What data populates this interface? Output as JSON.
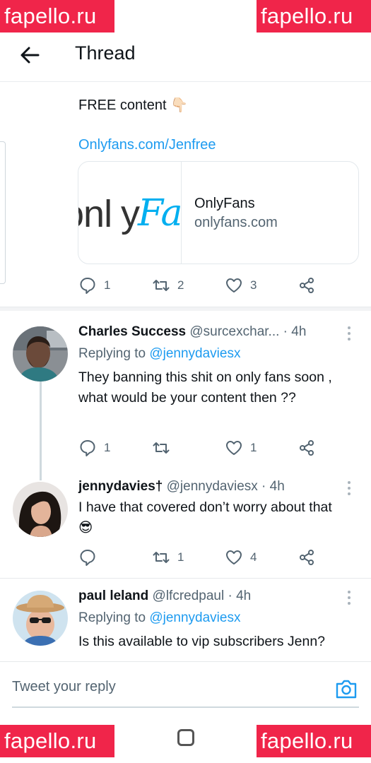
{
  "watermark": "fapello.ru",
  "header": {
    "title": "Thread"
  },
  "main_tweet": {
    "text": "FREE content 👇🏻",
    "link": "Onlyfans.com/Jenfree",
    "card": {
      "logo_text": "onlyFans",
      "title": "OnlyFans",
      "domain": "onlyfans.com"
    },
    "stats": {
      "replies": "1",
      "retweets": "2",
      "likes": "3"
    }
  },
  "replies": [
    {
      "name": "Charles Success",
      "meta": "@surcexchar... · 4h",
      "replying_label": "Replying to",
      "replying_to": "@jennydaviesx",
      "text": "They banning this shit on only fans soon , what would be your content then ??",
      "stats": {
        "replies": "1",
        "retweets": "",
        "likes": "1"
      }
    },
    {
      "name": "jennydavies†",
      "meta": "@jennydaviesx · 4h",
      "text": "I have that covered don’t worry about that 😎",
      "stats": {
        "replies": "",
        "retweets": "1",
        "likes": "4"
      }
    },
    {
      "name": "paul leland",
      "meta": "@lfcredpaul · 4h",
      "replying_label": "Replying to",
      "replying_to": "@jennydaviesx",
      "text": "Is this available to vip subscribers Jenn?"
    }
  ],
  "composer": {
    "placeholder": "Tweet your reply"
  },
  "colors": {
    "accent": "#1d9bf0",
    "watermark": "#f0254a",
    "muted": "#536471"
  }
}
